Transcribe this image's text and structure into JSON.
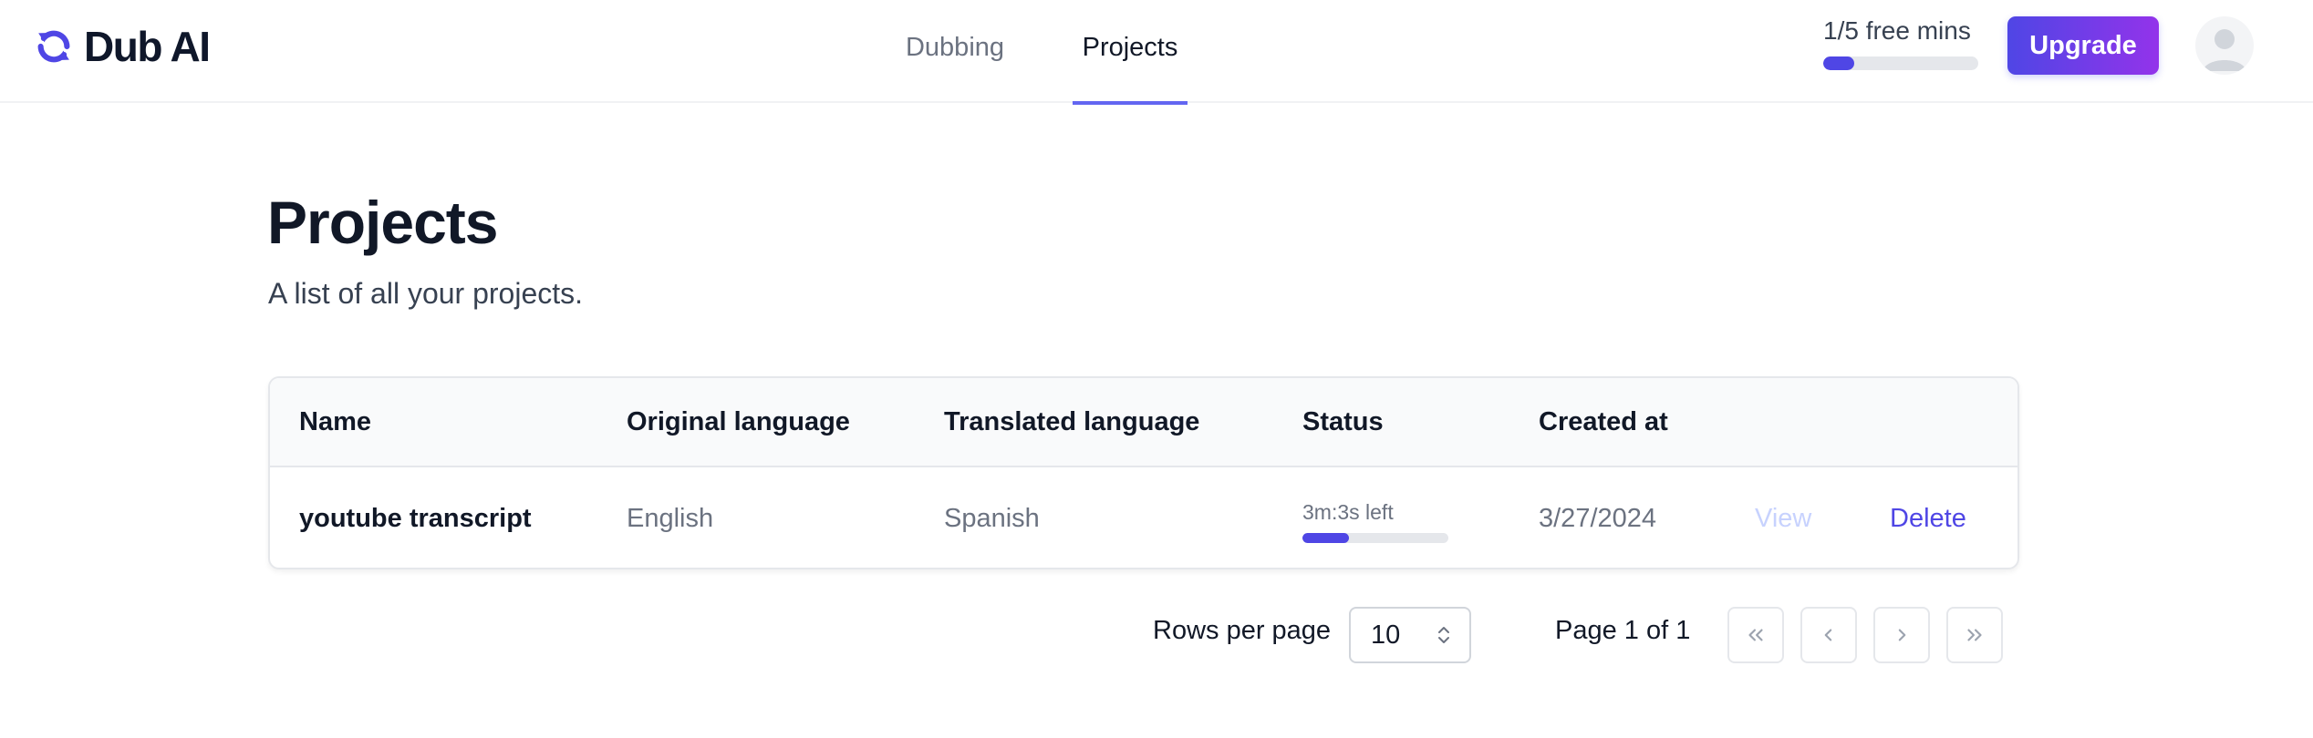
{
  "header": {
    "brand": "Dub AI",
    "nav": [
      {
        "label": "Dubbing",
        "active": false
      },
      {
        "label": "Projects",
        "active": true
      }
    ],
    "usage": {
      "label": "1/5 free mins",
      "used": 1,
      "total": 5
    },
    "upgrade_label": "Upgrade"
  },
  "page": {
    "title": "Projects",
    "subtitle": "A list of all your projects."
  },
  "table": {
    "columns": [
      "Name",
      "Original language",
      "Translated language",
      "Status",
      "Created at"
    ],
    "rows": [
      {
        "name": "youtube transcript",
        "original_language": "English",
        "translated_language": "Spanish",
        "status_text": "3m:3s left",
        "status_progress": 0.32,
        "created_at": "3/27/2024",
        "view_label": "View",
        "delete_label": "Delete"
      }
    ]
  },
  "pagination": {
    "rows_per_page_label": "Rows per page",
    "rows_per_page_value": "10",
    "page_info": "Page 1 of 1"
  },
  "colors": {
    "accent": "#4f46e5",
    "accent_gradient_end": "#9333ea",
    "disabled_link": "#c7d2fe"
  },
  "icons": [
    "sync-logo-icon",
    "avatar-icon",
    "select-chevrons-icon",
    "first-page-icon",
    "previous-page-icon",
    "next-page-icon",
    "last-page-icon"
  ]
}
